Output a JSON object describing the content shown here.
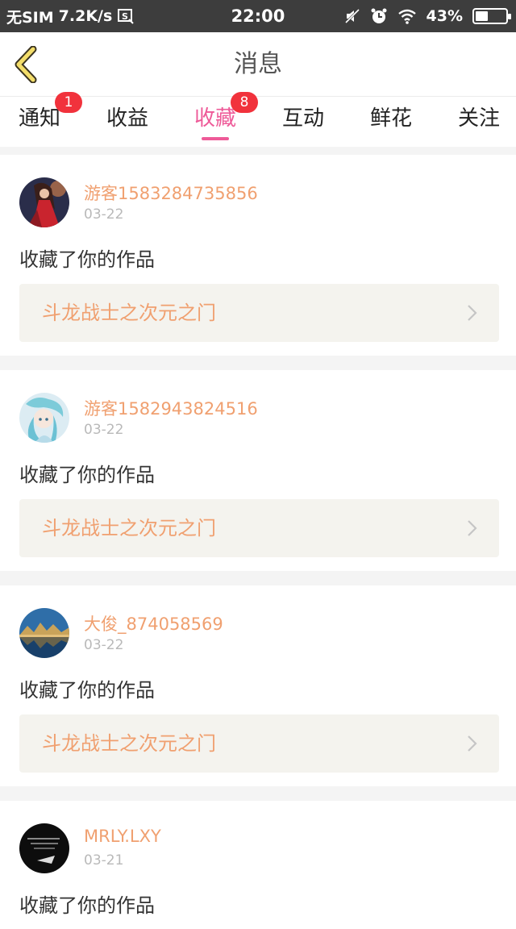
{
  "status_bar": {
    "carrier": "无SIM",
    "speed": "7.2K/s",
    "time": "22:00",
    "battery": "43%",
    "battery_level": 0.43,
    "icons": [
      "screenshot-icon",
      "mute-icon",
      "alarm-icon",
      "wifi-icon",
      "battery-icon"
    ]
  },
  "header": {
    "title": "消息",
    "back_icon": "chevron-left-icon"
  },
  "tabs": [
    {
      "label": "通知",
      "badge": "1"
    },
    {
      "label": "收益",
      "badge": ""
    },
    {
      "label": "收藏",
      "badge": "8",
      "active": true
    },
    {
      "label": "互动",
      "badge": ""
    },
    {
      "label": "鲜花",
      "badge": ""
    },
    {
      "label": "关注",
      "badge": ""
    }
  ],
  "colors": {
    "accent": "#ee5a98",
    "badge": "#f1323c",
    "username": "#f0a070",
    "status_bar": "#3d3d3d"
  },
  "items": [
    {
      "username": "游客1583284735856",
      "date": "03-22",
      "action": "收藏了你的作品",
      "work_title": "斗龙战士之次元之门"
    },
    {
      "username": "游客1582943824516",
      "date": "03-22",
      "action": "收藏了你的作品",
      "work_title": "斗龙战士之次元之门"
    },
    {
      "username": "大俊_874058569",
      "date": "03-22",
      "action": "收藏了你的作品",
      "work_title": "斗龙战士之次元之门"
    },
    {
      "username": "MRLY.LXY",
      "date": "03-21",
      "action": "收藏了你的作品",
      "work_title": ""
    }
  ]
}
